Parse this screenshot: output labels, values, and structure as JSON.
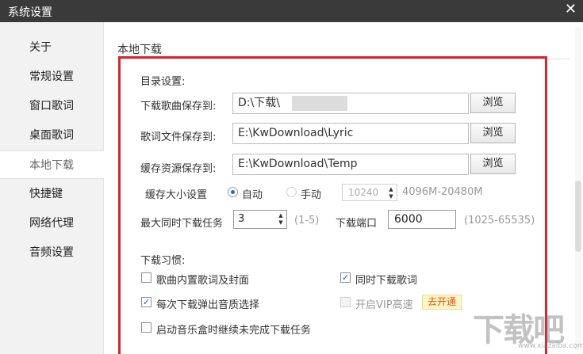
{
  "window": {
    "title": "系统设置",
    "close_glyph": "✕"
  },
  "sidebar": {
    "items": [
      {
        "label": "关于"
      },
      {
        "label": "常规设置"
      },
      {
        "label": "窗口歌词"
      },
      {
        "label": "桌面歌词"
      },
      {
        "label": "本地下载",
        "active": true
      },
      {
        "label": "快捷键"
      },
      {
        "label": "网络代理"
      },
      {
        "label": "音频设置"
      }
    ]
  },
  "main": {
    "section_title": "本地下载",
    "directory": {
      "heading": "目录设置:",
      "song": {
        "label": "下载歌曲保存到:",
        "value": "D:\\下载\\"
      },
      "lyric": {
        "label": "歌词文件保存到:",
        "value": "E:\\KwDownload\\Lyric"
      },
      "cache": {
        "label": "缓存资源保存到:",
        "value": "E:\\KwDownload\\Temp"
      },
      "browse_label": "浏览"
    },
    "cache_size": {
      "label": "缓存大小设置",
      "auto_label": "自动",
      "manual_label": "手动",
      "selected": "auto",
      "manual_value": "10240",
      "range_hint": "4096M-20480M"
    },
    "max_tasks": {
      "label": "最大同时下载任务",
      "value": "3",
      "hint": "(1-5)"
    },
    "port": {
      "label": "下载端口",
      "value": "6000",
      "hint": "(1025-65535)"
    },
    "habits": {
      "heading": "下载习惯:",
      "embed_lyrics": {
        "label": "歌曲内置歌词及封面",
        "checked": false
      },
      "sync_lyrics": {
        "label": "同时下载歌词",
        "checked": true
      },
      "quality_popup": {
        "label": "每次下载弹出音质选择",
        "checked": true
      },
      "vip_speed": {
        "label": "开启VIP高速",
        "checked": false,
        "disabled": true
      },
      "vip_action": "去开通",
      "resume_tasks": {
        "label": "启动音乐盒时继续未完成下载任务",
        "checked": false
      }
    },
    "check_glyph": "✓"
  },
  "watermark": {
    "text": "下载吧",
    "sub": "www.xiazaiba.com"
  },
  "colors": {
    "highlight_box": "#d9262e",
    "titlebar": "#3a3a3a",
    "accent": "#1a6fcd"
  }
}
